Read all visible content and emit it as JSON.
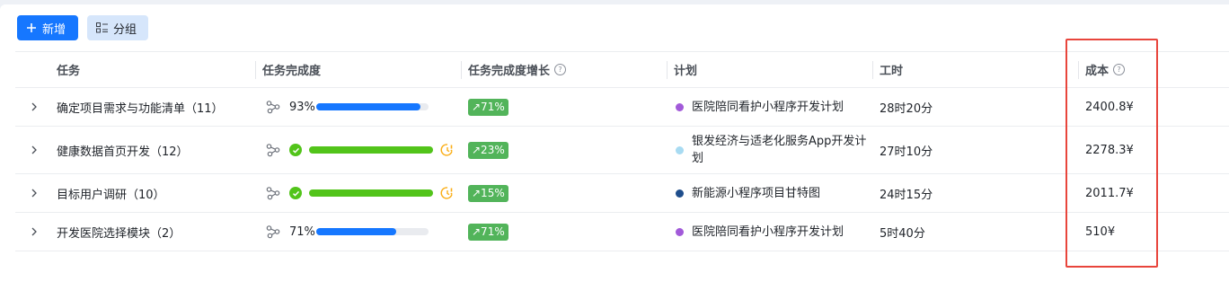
{
  "toolbar": {
    "add_label": "新增",
    "group_label": "分组",
    "add_icon": "plus-icon",
    "group_icon": "group-list-icon"
  },
  "columns": {
    "task": "任务",
    "progress": "任务完成度",
    "growth": "任务完成度增长",
    "plan": "计划",
    "time": "工时",
    "cost": "成本"
  },
  "colors": {
    "primary": "#1677ff",
    "progress_blue": "#1677ff",
    "progress_green": "#52c41a",
    "badge_green": "#52b45a",
    "warning_orange": "#faad14",
    "highlight_red": "#e8453c"
  },
  "rows": [
    {
      "task": "确定项目需求与功能清单（11）",
      "progress_pct": "93%",
      "progress_value": 93,
      "completed": false,
      "growth": "↗71%",
      "plan": "医院陪同看护小程序开发计划",
      "plan_color": "#a25ad9",
      "time": "28时20分",
      "cost": "2400.8¥"
    },
    {
      "task": "健康数据首页开发（12）",
      "progress_pct": "",
      "progress_value": 100,
      "completed": true,
      "growth": "↗23%",
      "plan": "银发经济与适老化服务App开发计划",
      "plan_color": "#a8dbf2",
      "time": "27时10分",
      "cost": "2278.3¥"
    },
    {
      "task": "目标用户调研（10）",
      "progress_pct": "",
      "progress_value": 100,
      "completed": true,
      "growth": "↗15%",
      "plan": "新能源小程序项目甘特图",
      "plan_color": "#1f4e8c",
      "time": "24时15分",
      "cost": "2011.7¥"
    },
    {
      "task": "开发医院选择模块（2）",
      "progress_pct": "71%",
      "progress_value": 71,
      "completed": false,
      "growth": "↗71%",
      "plan": "医院陪同看护小程序开发计划",
      "plan_color": "#a25ad9",
      "time": "5时40分",
      "cost": "510¥"
    }
  ]
}
